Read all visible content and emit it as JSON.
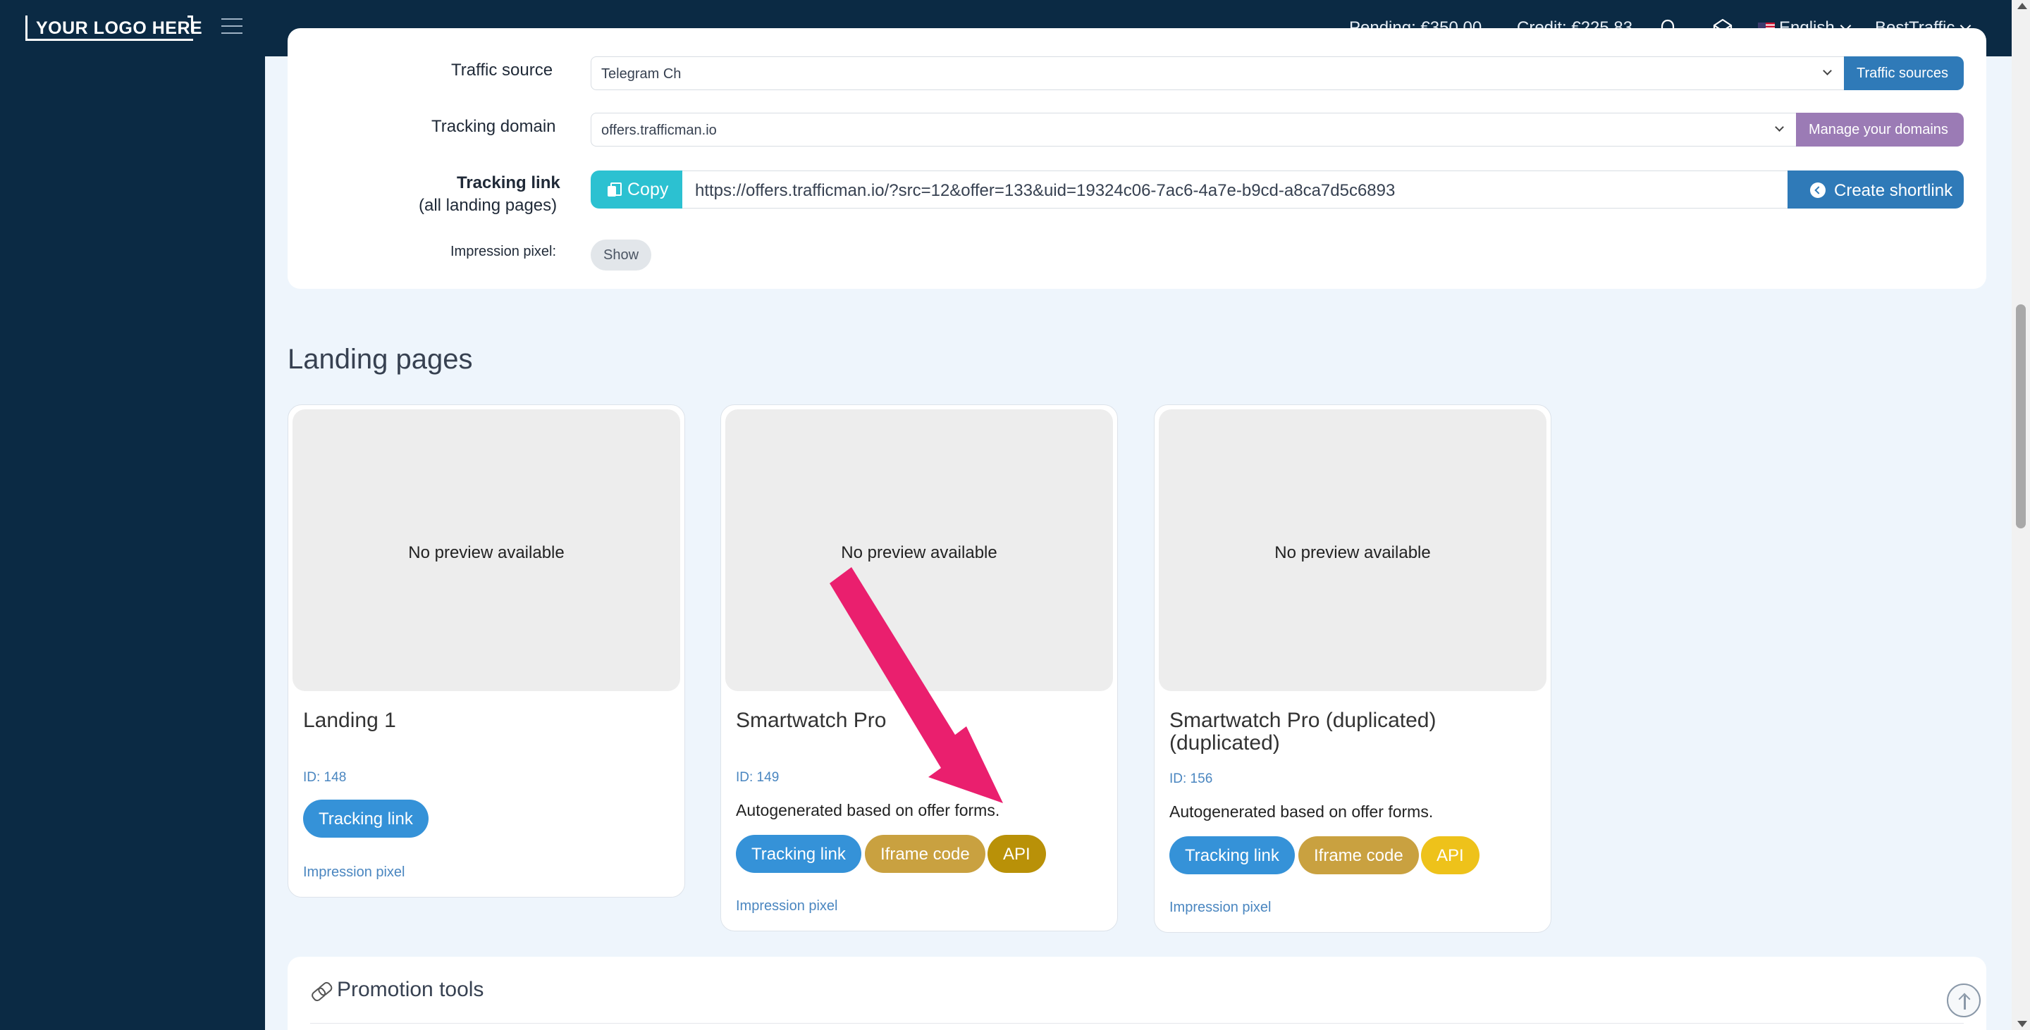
{
  "header": {
    "logo_text": "YOUR LOGO HERE",
    "pending": "Pending: €350.00",
    "credit": "Credit: €225.83",
    "language": "English",
    "account": "BestTraffic"
  },
  "settings": {
    "traffic_source_label": "Traffic source",
    "traffic_source_value": "Telegram Ch",
    "traffic_sources_button": "Traffic sources",
    "tracking_domain_label": "Tracking domain",
    "tracking_domain_value": "offers.trafficman.io",
    "manage_domains_button": "Manage your domains",
    "tracking_link_label": "Tracking link",
    "tracking_link_sublabel": "(all landing pages)",
    "copy_button": "Copy",
    "tracking_link_value": "https://offers.trafficman.io/?src=12&offer=133&uid=19324c06-7ac6-4a7e-b9cd-a8ca7d5c6893",
    "create_shortlink_button": "Create shortlink",
    "impression_pixel_label": "Impression pixel:",
    "show_button": "Show"
  },
  "landing_pages": {
    "title": "Landing pages",
    "cards": [
      {
        "preview_text": "No preview available",
        "name": "Landing 1",
        "id_text": "ID: 148",
        "tracking_button": "Tracking link",
        "impression_link": "Impression pixel"
      },
      {
        "preview_text": "No preview available",
        "name": "Smartwatch Pro",
        "id_text": "ID: 149",
        "description": "Autogenerated based on offer forms.",
        "tracking_button": "Tracking link",
        "iframe_button": "Iframe code",
        "api_button": "API",
        "impression_link": "Impression pixel"
      },
      {
        "preview_text": "No preview available",
        "name": "Smartwatch Pro (duplicated) (duplicated)",
        "id_text": "ID: 156",
        "description": "Autogenerated based on offer forms.",
        "tracking_button": "Tracking link",
        "iframe_button": "Iframe code",
        "api_button": "API",
        "impression_link": "Impression pixel"
      }
    ]
  },
  "promotion_tools": {
    "title": "Promotion tools"
  },
  "colors": {
    "header_bg": "#0b2a44",
    "page_bg": "#eef5fc",
    "primary_blue": "#3592d8",
    "copy_teal": "#2cc1d1",
    "manage_purple": "#9b7bb5",
    "annotation_arrow": "#ea1f6e"
  },
  "icons": [
    "hamburger-icon",
    "bell-icon",
    "mail-icon",
    "us-flag-icon",
    "chevron-down-icon",
    "copy-icon",
    "shortlink-icon",
    "link-icon",
    "arrow-up-icon"
  ]
}
